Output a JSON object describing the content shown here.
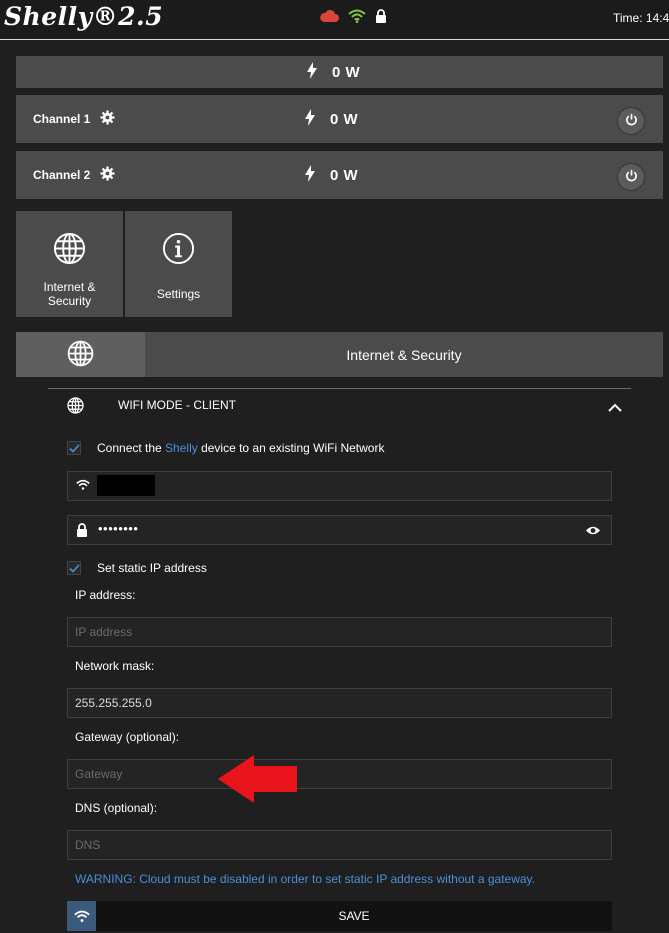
{
  "header": {
    "logo": "Shelly®2.5",
    "time_label": "Time: 14:4",
    "status_icons": [
      "cloud-icon",
      "wifi-signal-icon",
      "lock-icon"
    ],
    "cloud_color": "#d9453b",
    "wifi_color": "#8cc63f"
  },
  "power": {
    "total": "0 W",
    "channels": [
      {
        "label": "Channel 1",
        "value": "0 W"
      },
      {
        "label": "Channel 2",
        "value": "0 W"
      }
    ]
  },
  "tiles": [
    {
      "label": "Internet & Security",
      "icon": "globe-icon"
    },
    {
      "label": "Settings",
      "icon": "info-icon"
    }
  ],
  "section": {
    "title": "Internet & Security"
  },
  "wifi_mode": {
    "title": "WIFI MODE - CLIENT",
    "connect_prefix": "Connect the ",
    "connect_brand": "Shelly",
    "connect_suffix": " device to an existing WiFi Network",
    "password_value": "••••••••",
    "static_ip_label": "Set static IP address",
    "ip_label": "IP address:",
    "ip_placeholder": "IP address",
    "mask_label": "Network mask:",
    "mask_value": "255.255.255.0",
    "gateway_label": "Gateway (optional):",
    "gateway_placeholder": "Gateway",
    "dns_label": "DNS (optional):",
    "dns_placeholder": "DNS",
    "warning": "WARNING: Cloud must be disabled in order to set static IP address without a gateway.",
    "save_label": "SAVE"
  },
  "colors": {
    "accent_blue": "#4a90d9",
    "annotation_red": "#e8141c"
  }
}
